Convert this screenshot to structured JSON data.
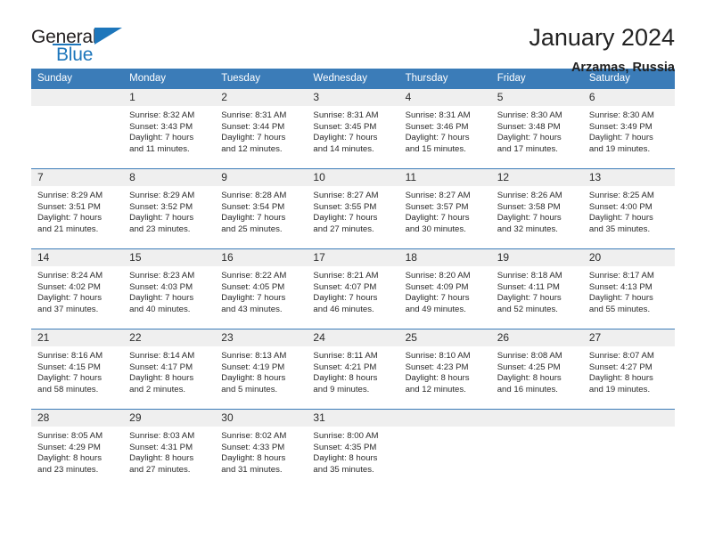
{
  "brand": {
    "name_part1": "General",
    "name_part2": "Blue",
    "logo_icon": "triangle-flag-icon"
  },
  "header": {
    "title": "January 2024",
    "subtitle": "Arzamas, Russia"
  },
  "calendar": {
    "weekday_headers": [
      "Sunday",
      "Monday",
      "Tuesday",
      "Wednesday",
      "Thursday",
      "Friday",
      "Saturday"
    ],
    "accent_color": "#3b7cb8",
    "daynum_bg": "#efefef",
    "weeks": [
      [
        {
          "day": "",
          "sunrise": "",
          "sunset": "",
          "daylight_line1": "",
          "daylight_line2": ""
        },
        {
          "day": "1",
          "sunrise": "Sunrise: 8:32 AM",
          "sunset": "Sunset: 3:43 PM",
          "daylight_line1": "Daylight: 7 hours",
          "daylight_line2": "and 11 minutes."
        },
        {
          "day": "2",
          "sunrise": "Sunrise: 8:31 AM",
          "sunset": "Sunset: 3:44 PM",
          "daylight_line1": "Daylight: 7 hours",
          "daylight_line2": "and 12 minutes."
        },
        {
          "day": "3",
          "sunrise": "Sunrise: 8:31 AM",
          "sunset": "Sunset: 3:45 PM",
          "daylight_line1": "Daylight: 7 hours",
          "daylight_line2": "and 14 minutes."
        },
        {
          "day": "4",
          "sunrise": "Sunrise: 8:31 AM",
          "sunset": "Sunset: 3:46 PM",
          "daylight_line1": "Daylight: 7 hours",
          "daylight_line2": "and 15 minutes."
        },
        {
          "day": "5",
          "sunrise": "Sunrise: 8:30 AM",
          "sunset": "Sunset: 3:48 PM",
          "daylight_line1": "Daylight: 7 hours",
          "daylight_line2": "and 17 minutes."
        },
        {
          "day": "6",
          "sunrise": "Sunrise: 8:30 AM",
          "sunset": "Sunset: 3:49 PM",
          "daylight_line1": "Daylight: 7 hours",
          "daylight_line2": "and 19 minutes."
        }
      ],
      [
        {
          "day": "7",
          "sunrise": "Sunrise: 8:29 AM",
          "sunset": "Sunset: 3:51 PM",
          "daylight_line1": "Daylight: 7 hours",
          "daylight_line2": "and 21 minutes."
        },
        {
          "day": "8",
          "sunrise": "Sunrise: 8:29 AM",
          "sunset": "Sunset: 3:52 PM",
          "daylight_line1": "Daylight: 7 hours",
          "daylight_line2": "and 23 minutes."
        },
        {
          "day": "9",
          "sunrise": "Sunrise: 8:28 AM",
          "sunset": "Sunset: 3:54 PM",
          "daylight_line1": "Daylight: 7 hours",
          "daylight_line2": "and 25 minutes."
        },
        {
          "day": "10",
          "sunrise": "Sunrise: 8:27 AM",
          "sunset": "Sunset: 3:55 PM",
          "daylight_line1": "Daylight: 7 hours",
          "daylight_line2": "and 27 minutes."
        },
        {
          "day": "11",
          "sunrise": "Sunrise: 8:27 AM",
          "sunset": "Sunset: 3:57 PM",
          "daylight_line1": "Daylight: 7 hours",
          "daylight_line2": "and 30 minutes."
        },
        {
          "day": "12",
          "sunrise": "Sunrise: 8:26 AM",
          "sunset": "Sunset: 3:58 PM",
          "daylight_line1": "Daylight: 7 hours",
          "daylight_line2": "and 32 minutes."
        },
        {
          "day": "13",
          "sunrise": "Sunrise: 8:25 AM",
          "sunset": "Sunset: 4:00 PM",
          "daylight_line1": "Daylight: 7 hours",
          "daylight_line2": "and 35 minutes."
        }
      ],
      [
        {
          "day": "14",
          "sunrise": "Sunrise: 8:24 AM",
          "sunset": "Sunset: 4:02 PM",
          "daylight_line1": "Daylight: 7 hours",
          "daylight_line2": "and 37 minutes."
        },
        {
          "day": "15",
          "sunrise": "Sunrise: 8:23 AM",
          "sunset": "Sunset: 4:03 PM",
          "daylight_line1": "Daylight: 7 hours",
          "daylight_line2": "and 40 minutes."
        },
        {
          "day": "16",
          "sunrise": "Sunrise: 8:22 AM",
          "sunset": "Sunset: 4:05 PM",
          "daylight_line1": "Daylight: 7 hours",
          "daylight_line2": "and 43 minutes."
        },
        {
          "day": "17",
          "sunrise": "Sunrise: 8:21 AM",
          "sunset": "Sunset: 4:07 PM",
          "daylight_line1": "Daylight: 7 hours",
          "daylight_line2": "and 46 minutes."
        },
        {
          "day": "18",
          "sunrise": "Sunrise: 8:20 AM",
          "sunset": "Sunset: 4:09 PM",
          "daylight_line1": "Daylight: 7 hours",
          "daylight_line2": "and 49 minutes."
        },
        {
          "day": "19",
          "sunrise": "Sunrise: 8:18 AM",
          "sunset": "Sunset: 4:11 PM",
          "daylight_line1": "Daylight: 7 hours",
          "daylight_line2": "and 52 minutes."
        },
        {
          "day": "20",
          "sunrise": "Sunrise: 8:17 AM",
          "sunset": "Sunset: 4:13 PM",
          "daylight_line1": "Daylight: 7 hours",
          "daylight_line2": "and 55 minutes."
        }
      ],
      [
        {
          "day": "21",
          "sunrise": "Sunrise: 8:16 AM",
          "sunset": "Sunset: 4:15 PM",
          "daylight_line1": "Daylight: 7 hours",
          "daylight_line2": "and 58 minutes."
        },
        {
          "day": "22",
          "sunrise": "Sunrise: 8:14 AM",
          "sunset": "Sunset: 4:17 PM",
          "daylight_line1": "Daylight: 8 hours",
          "daylight_line2": "and 2 minutes."
        },
        {
          "day": "23",
          "sunrise": "Sunrise: 8:13 AM",
          "sunset": "Sunset: 4:19 PM",
          "daylight_line1": "Daylight: 8 hours",
          "daylight_line2": "and 5 minutes."
        },
        {
          "day": "24",
          "sunrise": "Sunrise: 8:11 AM",
          "sunset": "Sunset: 4:21 PM",
          "daylight_line1": "Daylight: 8 hours",
          "daylight_line2": "and 9 minutes."
        },
        {
          "day": "25",
          "sunrise": "Sunrise: 8:10 AM",
          "sunset": "Sunset: 4:23 PM",
          "daylight_line1": "Daylight: 8 hours",
          "daylight_line2": "and 12 minutes."
        },
        {
          "day": "26",
          "sunrise": "Sunrise: 8:08 AM",
          "sunset": "Sunset: 4:25 PM",
          "daylight_line1": "Daylight: 8 hours",
          "daylight_line2": "and 16 minutes."
        },
        {
          "day": "27",
          "sunrise": "Sunrise: 8:07 AM",
          "sunset": "Sunset: 4:27 PM",
          "daylight_line1": "Daylight: 8 hours",
          "daylight_line2": "and 19 minutes."
        }
      ],
      [
        {
          "day": "28",
          "sunrise": "Sunrise: 8:05 AM",
          "sunset": "Sunset: 4:29 PM",
          "daylight_line1": "Daylight: 8 hours",
          "daylight_line2": "and 23 minutes."
        },
        {
          "day": "29",
          "sunrise": "Sunrise: 8:03 AM",
          "sunset": "Sunset: 4:31 PM",
          "daylight_line1": "Daylight: 8 hours",
          "daylight_line2": "and 27 minutes."
        },
        {
          "day": "30",
          "sunrise": "Sunrise: 8:02 AM",
          "sunset": "Sunset: 4:33 PM",
          "daylight_line1": "Daylight: 8 hours",
          "daylight_line2": "and 31 minutes."
        },
        {
          "day": "31",
          "sunrise": "Sunrise: 8:00 AM",
          "sunset": "Sunset: 4:35 PM",
          "daylight_line1": "Daylight: 8 hours",
          "daylight_line2": "and 35 minutes."
        },
        {
          "day": "",
          "sunrise": "",
          "sunset": "",
          "daylight_line1": "",
          "daylight_line2": ""
        },
        {
          "day": "",
          "sunrise": "",
          "sunset": "",
          "daylight_line1": "",
          "daylight_line2": ""
        },
        {
          "day": "",
          "sunrise": "",
          "sunset": "",
          "daylight_line1": "",
          "daylight_line2": ""
        }
      ]
    ]
  }
}
